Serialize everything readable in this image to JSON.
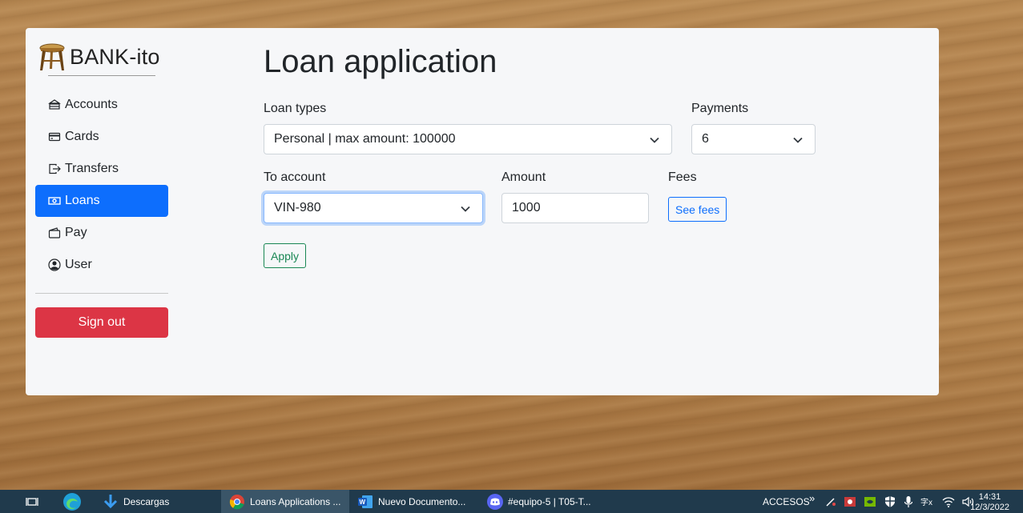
{
  "sidebar": {
    "brand": "BANK-ito",
    "items": [
      {
        "label": "Accounts",
        "icon": "bank-icon"
      },
      {
        "label": "Cards",
        "icon": "credit-card-icon"
      },
      {
        "label": "Transfers",
        "icon": "transfer-icon"
      },
      {
        "label": "Loans",
        "icon": "cash-icon",
        "active": true
      },
      {
        "label": "Pay",
        "icon": "wallet-icon"
      },
      {
        "label": "User",
        "icon": "user-circle-icon"
      }
    ],
    "sign_out": "Sign out"
  },
  "main": {
    "title": "Loan application",
    "loan_types": {
      "label": "Loan types",
      "value": "Personal | max amount: 100000"
    },
    "payments": {
      "label": "Payments",
      "value": "6"
    },
    "to_account": {
      "label": "To account",
      "value": "VIN-980"
    },
    "amount": {
      "label": "Amount",
      "value": "1000"
    },
    "fees": {
      "label": "Fees",
      "button": "See fees"
    },
    "apply": "Apply"
  },
  "taskbar": {
    "items": [
      {
        "label": "Descargas"
      },
      {
        "label": "Loans Applications ..."
      },
      {
        "label": "Nuevo Documento..."
      },
      {
        "label": "#equipo-5 | T05-T..."
      }
    ],
    "tray_label": "ACCESOS",
    "chevron": "»",
    "time": "14:31",
    "date": "12/3/2022"
  },
  "colors": {
    "primary": "#0d6efd",
    "danger": "#dc3545",
    "success": "#198754",
    "taskbar": "#203a4c"
  }
}
